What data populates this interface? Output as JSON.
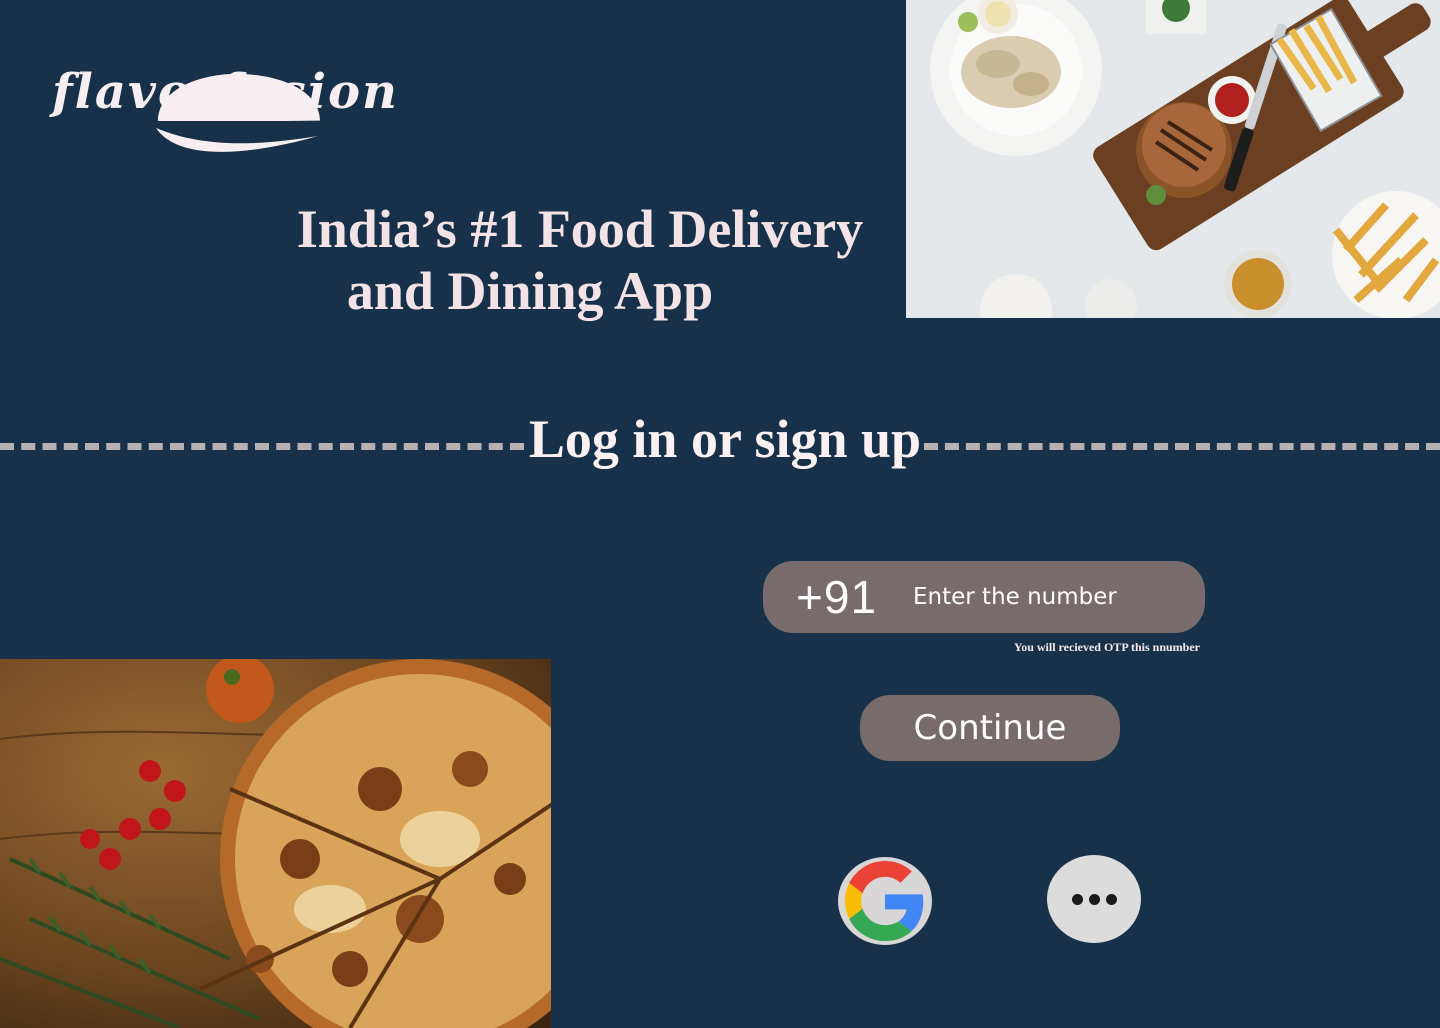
{
  "brand": {
    "logo_text": "flavorfusion"
  },
  "hero": {
    "headline_line1": "India’s #1 Food Delivery",
    "headline_line2": "and Dining App"
  },
  "auth": {
    "heading": "Log in or sign up",
    "country_code": "+91",
    "phone_placeholder": "Enter the number",
    "otp_note": "You will recieved OTP this nnumber",
    "continue_label": "Continue"
  },
  "social": {
    "google_icon": "google-icon",
    "more_icon": "more-options-icon"
  },
  "images": {
    "top_photo": "burger-fries-calamari-photo",
    "bottom_photo": "pizza-photo"
  },
  "colors": {
    "background": "#163149",
    "button": "#786b6b",
    "headline": "#f3e3e6",
    "social_button": "#d8d6d6"
  }
}
